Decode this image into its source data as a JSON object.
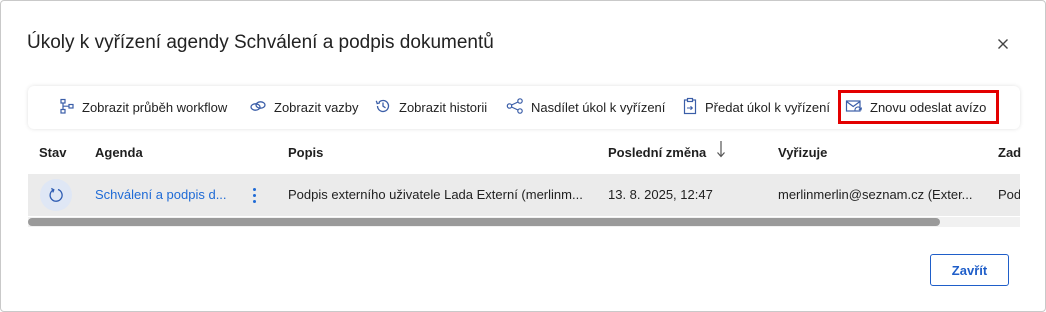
{
  "dialog": {
    "title": "Úkoly k vyřízení agendy Schválení a podpis dokumentů",
    "close_icon": "close-icon"
  },
  "toolbar": {
    "items": [
      {
        "label": "Zobrazit průběh workflow",
        "icon": "workflow-icon"
      },
      {
        "label": "Zobrazit vazby",
        "icon": "link-icon"
      },
      {
        "label": "Zobrazit historii",
        "icon": "history-icon"
      },
      {
        "label": "Nasdílet úkol k vyřízení",
        "icon": "share-icon"
      },
      {
        "label": "Předat úkol k vyřízení",
        "icon": "clipboard-icon"
      },
      {
        "label": "Znovu odeslat avízo",
        "icon": "mail-resend-icon"
      }
    ],
    "highlight_color": "#e30000"
  },
  "table": {
    "columns": [
      "Stav",
      "Agenda",
      "Popis",
      "Poslední změna",
      "Vyřizuje",
      "Zad"
    ],
    "sort_icon": "arrow-down-icon",
    "rows": [
      {
        "status_icon": "refresh-icon",
        "agenda": "Schválení a podpis d...",
        "popis": "Podpis externího uživatele Lada Externí (merlinm...",
        "posledni_zmena": "13. 8. 2025, 12:47",
        "vyrizuje": "merlinmerlin@seznam.cz (Exter...",
        "zad": "Pod"
      }
    ]
  },
  "footer": {
    "close_button": "Zavřít"
  },
  "colors": {
    "link": "#1f6bd6",
    "primary": "#1f5ec9",
    "row_bg": "#ebebeb"
  }
}
